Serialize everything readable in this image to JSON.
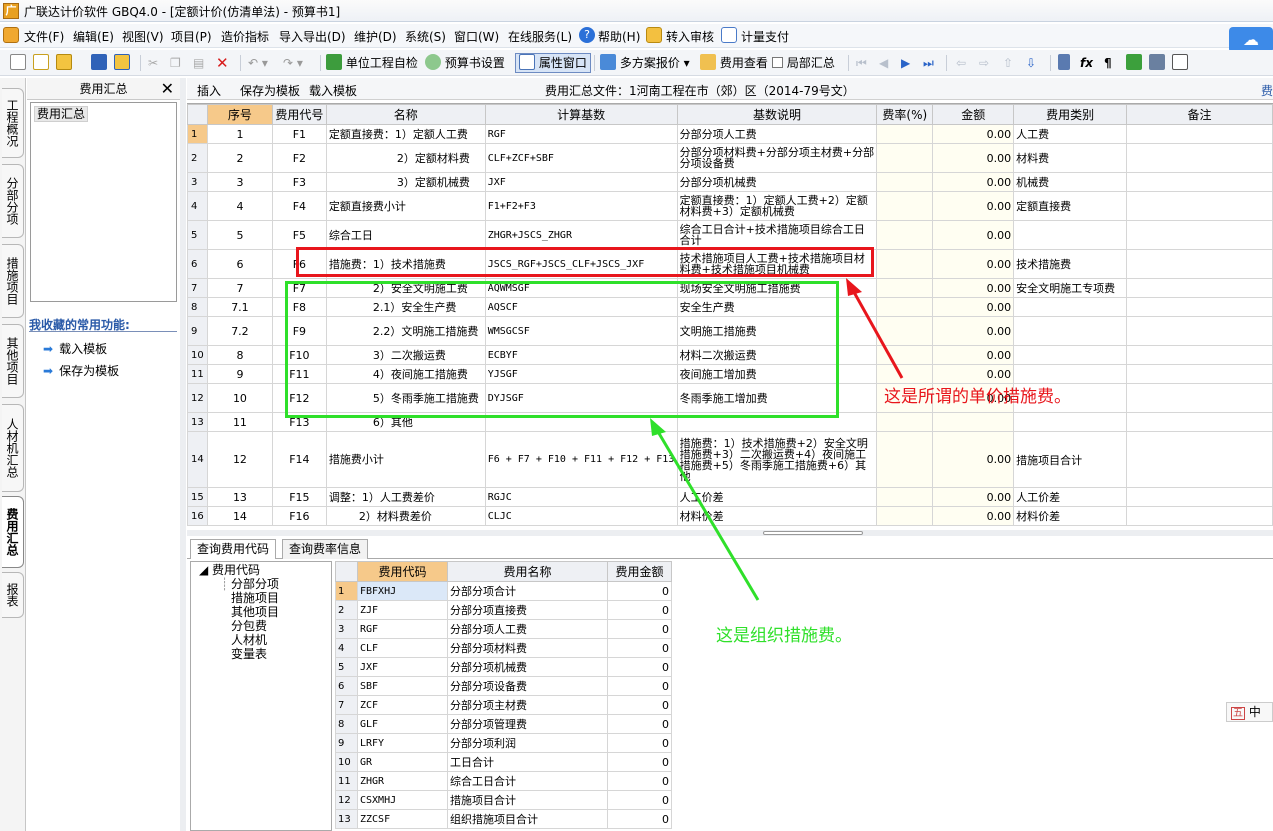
{
  "title": "广联达计价软件 GBQ4.0 - [定额计价(仿清单法) - 预算书1]",
  "menu": [
    {
      "label": "文件(F)",
      "icon": "file-icon"
    },
    {
      "label": "编辑(E)"
    },
    {
      "label": "视图(V)"
    },
    {
      "label": "项目(P)"
    },
    {
      "label": "造价指标"
    },
    {
      "label": "导入导出(D)"
    },
    {
      "label": "维护(D)"
    },
    {
      "label": "系统(S)"
    },
    {
      "label": "窗口(W)"
    },
    {
      "label": "在线服务(L)"
    },
    {
      "label": "帮助(H)",
      "icon": "help-icon"
    },
    {
      "label": "转入审核",
      "icon": "audit-icon"
    },
    {
      "label": "计量支付",
      "icon": "pay-icon"
    }
  ],
  "toolbar": {
    "check": "单位工程自检",
    "settings": "预算书设置",
    "props": "属性窗口",
    "multi": "多方案报价",
    "fee_view": "费用查看",
    "partial": "局部汇总"
  },
  "left_tabs": [
    "工程概况",
    "分部分项",
    "措施项目",
    "其他项目",
    "人材机汇总",
    "费用汇总",
    "报表"
  ],
  "left_panel": {
    "header": "费用汇总",
    "tree_node": "费用汇总",
    "fav_title": "我收藏的常用功能:",
    "fav_items": [
      "载入模板",
      "保存为模板"
    ]
  },
  "main_header": {
    "insert": "插入",
    "save_tpl": "保存为模板",
    "load_tpl": "载入模板",
    "file_label": "费用汇总文件：1河南工程在市（郊）区（2014-79号文）",
    "trailing": "费"
  },
  "grid": {
    "columns": [
      "序号",
      "费用代号",
      "名称",
      "计算基数",
      "基数说明",
      "费率(%)",
      "金额",
      "费用类别",
      "备注"
    ],
    "rows": [
      {
        "rn": "1",
        "seq": "1",
        "code": "F1",
        "name": "定额直接费：1）定额人工费",
        "base": "RGF",
        "desc": "分部分项人工费",
        "rate": "",
        "amount": "0.00",
        "cat": "人工费"
      },
      {
        "rn": "2",
        "seq": "2",
        "code": "F2",
        "name": "2）定额材料费",
        "base": "CLF+ZCF+SBF",
        "desc": "分部分项材料费+分部分项主材费+分部分项设备费",
        "rate": "",
        "amount": "0.00",
        "cat": "材料费"
      },
      {
        "rn": "3",
        "seq": "3",
        "code": "F3",
        "name": "3）定额机械费",
        "base": "JXF",
        "desc": "分部分项机械费",
        "rate": "",
        "amount": "0.00",
        "cat": "机械费"
      },
      {
        "rn": "4",
        "seq": "4",
        "code": "F4",
        "name": "定额直接费小计",
        "base": "F1+F2+F3",
        "desc": "定额直接费：1）定额人工费+2）定额材料费+3）定额机械费",
        "rate": "",
        "amount": "0.00",
        "cat": "定额直接费"
      },
      {
        "rn": "5",
        "seq": "5",
        "code": "F5",
        "name": "综合工日",
        "base": "ZHGR+JSCS_ZHGR",
        "desc": "综合工日合计+技术措施项目综合工日合计",
        "rate": "",
        "amount": "0.00",
        "cat": ""
      },
      {
        "rn": "6",
        "seq": "6",
        "code": "F6",
        "name": "措施费：1）技术措施费",
        "base": "JSCS_RGF+JSCS_CLF+JSCS_JXF",
        "desc": "技术措施项目人工费+技术措施项目材料费+技术措施项目机械费",
        "rate": "",
        "amount": "0.00",
        "cat": "技术措施费"
      },
      {
        "rn": "7",
        "seq": "7",
        "code": "F7",
        "name": "2）安全文明施工费",
        "base": "AQWMSGF",
        "desc": "现场安全文明施工措施费",
        "rate": "",
        "amount": "0.00",
        "cat": "安全文明施工专项费"
      },
      {
        "rn": "8",
        "seq": "7.1",
        "code": "F8",
        "name": "2.1）安全生产费",
        "base": "AQSCF",
        "desc": "安全生产费",
        "rate": "",
        "amount": "0.00",
        "cat": ""
      },
      {
        "rn": "9",
        "seq": "7.2",
        "code": "F9",
        "name": "2.2）文明施工措施费",
        "base": "WMSGCSF",
        "desc": "文明施工措施费",
        "rate": "",
        "amount": "0.00",
        "cat": ""
      },
      {
        "rn": "10",
        "seq": "8",
        "code": "F10",
        "name": "3）二次搬运费",
        "base": "ECBYF",
        "desc": "材料二次搬运费",
        "rate": "",
        "amount": "0.00",
        "cat": ""
      },
      {
        "rn": "11",
        "seq": "9",
        "code": "F11",
        "name": "4）夜间施工措施费",
        "base": "YJSGF",
        "desc": "夜间施工增加费",
        "rate": "",
        "amount": "0.00",
        "cat": ""
      },
      {
        "rn": "12",
        "seq": "10",
        "code": "F12",
        "name": "5）冬雨季施工措施费",
        "base": "DYJSGF",
        "desc": "冬雨季施工增加费",
        "rate": "",
        "amount": "0.00",
        "cat": ""
      },
      {
        "rn": "13",
        "seq": "11",
        "code": "F13",
        "name": "6）其他",
        "base": "",
        "desc": "",
        "rate": "",
        "amount": "",
        "cat": ""
      },
      {
        "rn": "14",
        "seq": "12",
        "code": "F14",
        "name": "措施费小计",
        "base": "F6 + F7 + F10 + F11 + F12 + F13",
        "desc": "措施费：1）技术措施费+2）安全文明措施费+3）二次搬运费+4）夜间施工措施费+5）冬雨季施工措施费+6）其他",
        "rate": "",
        "amount": "0.00",
        "cat": "措施项目合计"
      },
      {
        "rn": "15",
        "seq": "13",
        "code": "F15",
        "name": "调整：1）人工费差价",
        "base": "RGJC",
        "desc": "人工价差",
        "rate": "",
        "amount": "0.00",
        "cat": "人工价差"
      },
      {
        "rn": "16",
        "seq": "14",
        "code": "F16",
        "name": "2）材料费差价",
        "base": "CLJC",
        "desc": "材料价差",
        "rate": "",
        "amount": "0.00",
        "cat": "材料价差"
      }
    ]
  },
  "bottom": {
    "tabs": [
      "查询费用代码",
      "查询费率信息"
    ],
    "tree": [
      "费用代码",
      "分部分项",
      "措施项目",
      "其他项目",
      "分包费",
      "人材机",
      "变量表"
    ],
    "columns": [
      "费用代码",
      "费用名称",
      "费用金额"
    ],
    "rows": [
      {
        "rn": "1",
        "code": "FBFXHJ",
        "name": "分部分项合计",
        "amount": "0"
      },
      {
        "rn": "2",
        "code": "ZJF",
        "name": "分部分项直接费",
        "amount": "0"
      },
      {
        "rn": "3",
        "code": "RGF",
        "name": "分部分项人工费",
        "amount": "0"
      },
      {
        "rn": "4",
        "code": "CLF",
        "name": "分部分项材料费",
        "amount": "0"
      },
      {
        "rn": "5",
        "code": "JXF",
        "name": "分部分项机械费",
        "amount": "0"
      },
      {
        "rn": "6",
        "code": "SBF",
        "name": "分部分项设备费",
        "amount": "0"
      },
      {
        "rn": "7",
        "code": "ZCF",
        "name": "分部分项主材费",
        "amount": "0"
      },
      {
        "rn": "8",
        "code": "GLF",
        "name": "分部分项管理费",
        "amount": "0"
      },
      {
        "rn": "9",
        "code": "LRFY",
        "name": "分部分项利润",
        "amount": "0"
      },
      {
        "rn": "10",
        "code": "GR",
        "name": "工日合计",
        "amount": "0"
      },
      {
        "rn": "11",
        "code": "ZHGR",
        "name": "综合工日合计",
        "amount": "0"
      },
      {
        "rn": "12",
        "code": "CSXMHJ",
        "name": "措施项目合计",
        "amount": "0"
      },
      {
        "rn": "13",
        "code": "ZZCSF",
        "name": "组织措施项目合计",
        "amount": "0"
      }
    ]
  },
  "annotations": {
    "red_text": "这是所谓的单价措施费。",
    "green_text": "这是组织措施费。",
    "red_color": "#e8161c",
    "green_color": "#2fe02a"
  },
  "ime": "中"
}
